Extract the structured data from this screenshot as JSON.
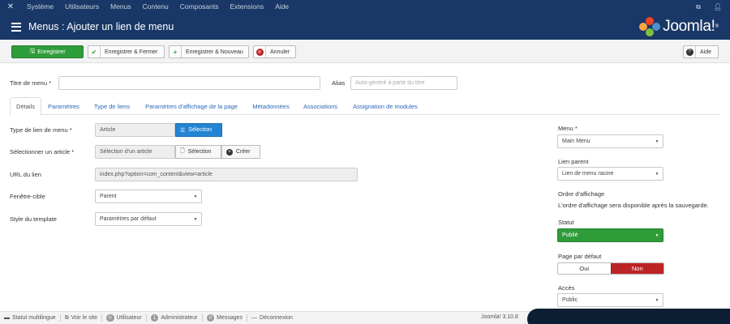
{
  "topnav": {
    "items": [
      "Système",
      "Utilisateurs",
      "Menus",
      "Contenu",
      "Composants",
      "Extensions",
      "Aide"
    ]
  },
  "header": {
    "title": "Menus : Ajouter un lien de menu",
    "brand": "Joomla!",
    "brand_mark": "®"
  },
  "toolbar": {
    "save": "Enregistrer",
    "save_close": "Enregistrer & Fermer",
    "save_new": "Enregistrer & Nouveau",
    "cancel": "Annuler",
    "help": "Aide"
  },
  "form": {
    "title_label": "Titre de menu *",
    "title_value": "",
    "alias_label": "Alias",
    "alias_placeholder": "Auto-généré à partir du titre"
  },
  "tabs": [
    "Détails",
    "Paramètres",
    "Type de liens",
    "Paramètres d'affichage de la page",
    "Métadonnées",
    "Associations",
    "Assignation de modules"
  ],
  "details": {
    "link_type_label": "Type de lien de menu *",
    "link_type_value": "Article",
    "select_btn": "Sélection",
    "select_article_label": "Sélectionner un article *",
    "select_article_value": "Sélection d'un article",
    "select_btn2": "Sélection",
    "create_btn": "Créer",
    "url_label": "URL du lien",
    "url_value": "index.php?option=com_content&view=article",
    "target_label": "Fenêtre-cible",
    "target_value": "Parent",
    "style_label": "Style du template",
    "style_value": "Paramètres par défaut"
  },
  "sidebar": {
    "menu_label": "Menu *",
    "menu_value": "Main Menu",
    "parent_label": "Lien parent",
    "parent_value": "Lien de menu racine",
    "order_label": "Ordre d'affichage",
    "order_text": "L'ordre d'affichage sera disponible après la sauvegarde.",
    "status_label": "Statut",
    "status_value": "Publié",
    "default_label": "Page par défaut",
    "default_yes": "Oui",
    "default_no": "Non",
    "access_label": "Accès",
    "access_value": "Public"
  },
  "statusbar": {
    "multilang": "Statut multilingue",
    "view_site": "Voir le site",
    "users_count": "0",
    "users_label": "Utilisateur",
    "admins_count": "1",
    "admins_label": "Administrateur",
    "messages_count": "0",
    "messages_label": "Messages",
    "logout": "Déconnexion",
    "version": "Joomla! 3.10.8"
  },
  "colors": {
    "nav_bg": "#1a3867",
    "save_green": "#2f9c3a",
    "select_blue": "#2384d3",
    "status_green": "#2f9c3a",
    "no_red": "#bd2426",
    "link_blue": "#2a69b8"
  },
  "icons": [
    "joomla-logo-icon",
    "list-icon",
    "external-link-icon",
    "user-icon",
    "check-icon",
    "plus-icon",
    "times-circle-icon",
    "question-icon",
    "file-icon",
    "plus-circle-icon",
    "chevron-down-icon"
  ]
}
